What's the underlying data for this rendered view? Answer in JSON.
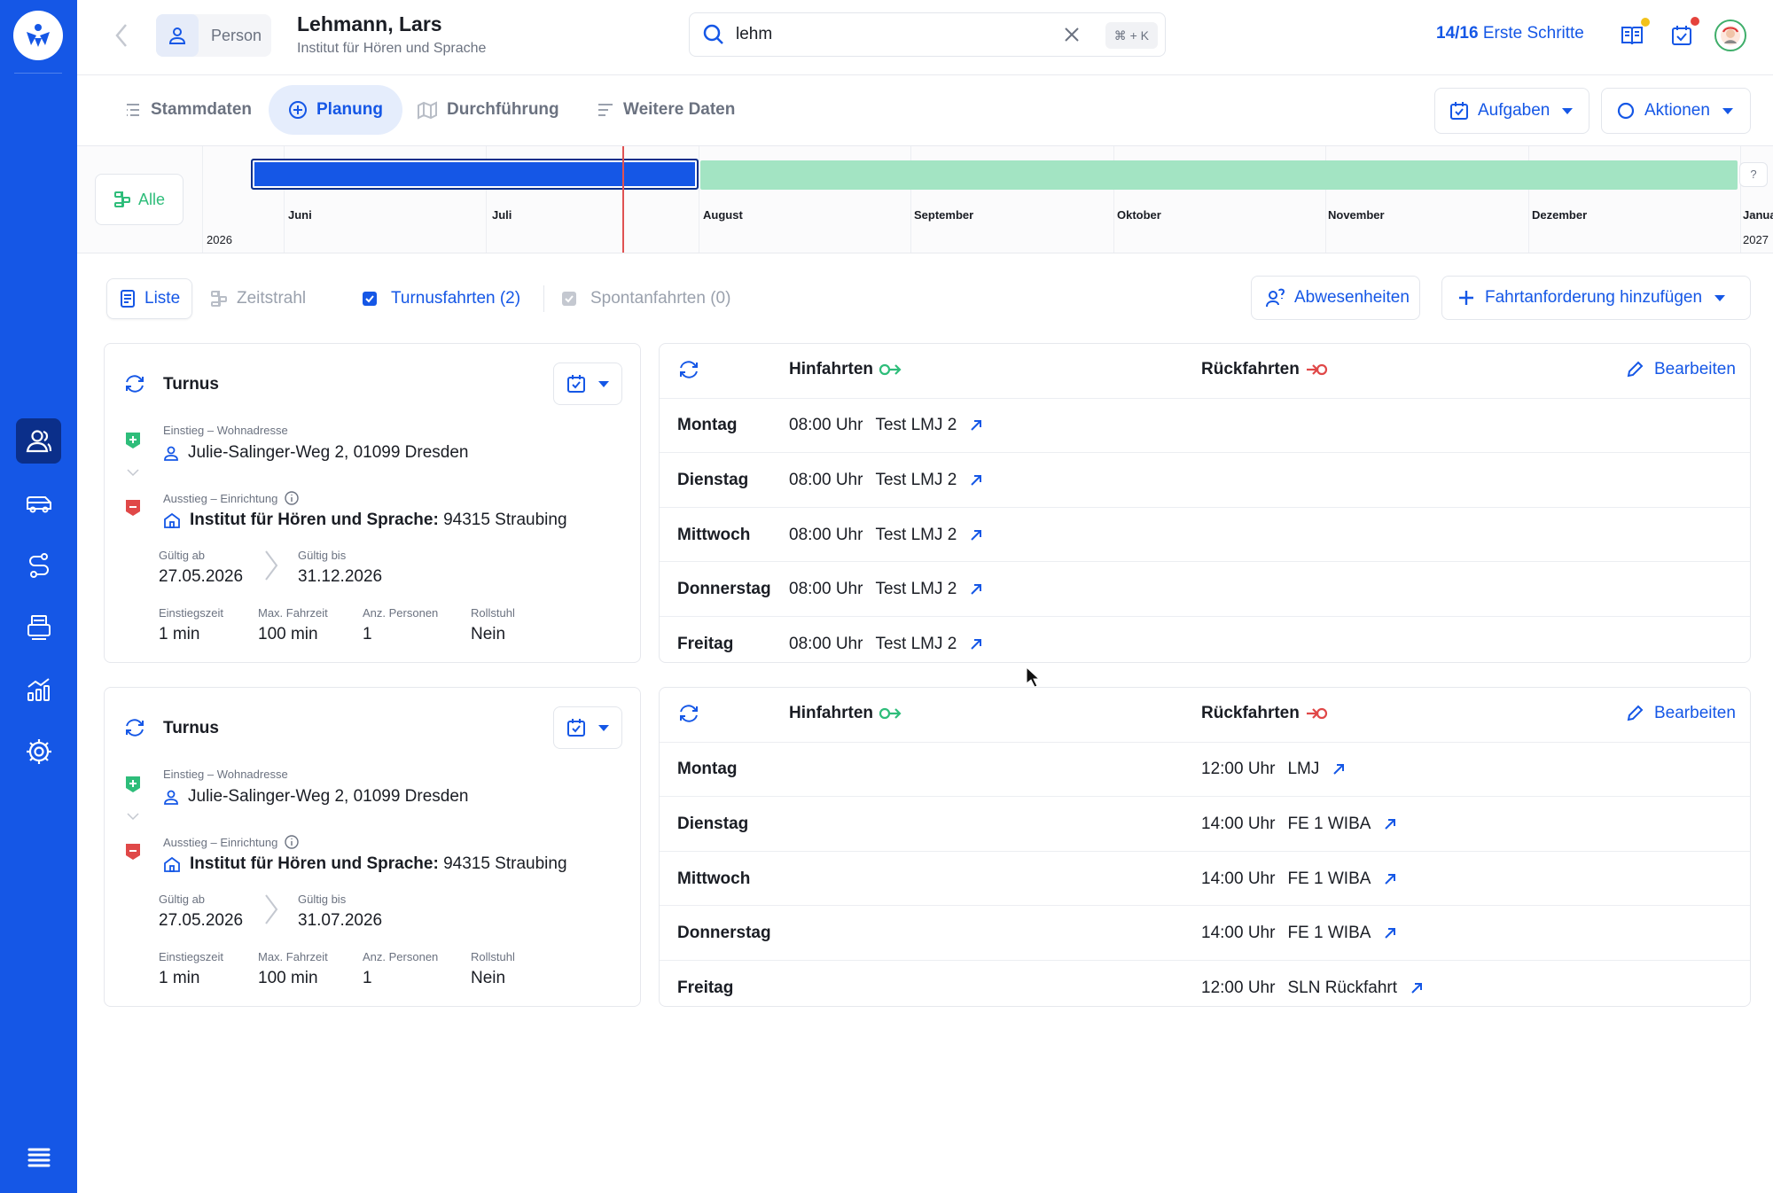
{
  "header": {
    "chip_label": "Person",
    "name": "Lehmann, Lars",
    "subtitle": "Institut für Hören und Sprache",
    "search_value": "lehm",
    "search_shortcut": "⌘ + K",
    "steps_count": "14/16",
    "steps_label": "Erste Schritte"
  },
  "sidebar": {
    "items": [
      "contacts-icon",
      "vehicle-icon",
      "route-icon",
      "print-icon",
      "analytics-icon",
      "settings-icon"
    ],
    "active": "contacts-icon"
  },
  "tabs": [
    {
      "label": "Stammdaten"
    },
    {
      "label": "Planung"
    },
    {
      "label": "Durchführung"
    },
    {
      "label": "Weitere Daten"
    }
  ],
  "actions": {
    "tasks_label": "Aufgaben",
    "actions_label": "Aktionen"
  },
  "timeline": {
    "filter_label": "Alle",
    "months": [
      "Juni",
      "Juli",
      "August",
      "September",
      "Oktober",
      "November",
      "Dezember",
      "Janua"
    ],
    "year_start": "2026",
    "year_end": "2027",
    "help": "?"
  },
  "filters": {
    "list_label": "Liste",
    "timeline_label": "Zeitstrahl",
    "turnus_label": "Turnusfahrten (2)",
    "spontan_label": "Spontanfahrten (0)",
    "absences_label": "Abwesenheiten",
    "add_label": "Fahrtanforderung hinzufügen"
  },
  "turnus": [
    {
      "title": "Turnus",
      "pickup_label": "Einstieg – Wohnadresse",
      "pickup_address": "Julie-Salinger-Weg 2, 01099 Dresden",
      "dropoff_label": "Ausstieg – Einrichtung",
      "dropoff_name": "Institut für Hören und Sprache:",
      "dropoff_city": "94315 Straubing",
      "valid_from_label": "Gültig ab",
      "valid_from": "27.05.2026",
      "valid_to_label": "Gültig bis",
      "valid_to": "31.12.2026",
      "boarding_label": "Einstiegszeit",
      "boarding": "1 min",
      "maxride_label": "Max. Fahrzeit",
      "maxride": "100 min",
      "persons_label": "Anz. Personen",
      "persons": "1",
      "wheelchair_label": "Rollstuhl",
      "wheelchair": "Nein"
    },
    {
      "title": "Turnus",
      "pickup_label": "Einstieg – Wohnadresse",
      "pickup_address": "Julie-Salinger-Weg 2, 01099 Dresden",
      "dropoff_label": "Ausstieg – Einrichtung",
      "dropoff_name": "Institut für Hören und Sprache:",
      "dropoff_city": "94315 Straubing",
      "valid_from_label": "Gültig ab",
      "valid_from": "27.05.2026",
      "valid_to_label": "Gültig bis",
      "valid_to": "31.07.2026",
      "boarding_label": "Einstiegszeit",
      "boarding": "1 min",
      "maxride_label": "Max. Fahrzeit",
      "maxride": "100 min",
      "persons_label": "Anz. Personen",
      "persons": "1",
      "wheelchair_label": "Rollstuhl",
      "wheelchair": "Nein"
    }
  ],
  "schedules": [
    {
      "outbound_label": "Hinfahrten",
      "return_label": "Rückfahrten",
      "edit_label": "Bearbeiten",
      "rows": [
        {
          "day": "Montag",
          "out_time": "08:00 Uhr",
          "out_name": "Test LMJ 2"
        },
        {
          "day": "Dienstag",
          "out_time": "08:00 Uhr",
          "out_name": "Test LMJ 2"
        },
        {
          "day": "Mittwoch",
          "out_time": "08:00 Uhr",
          "out_name": "Test LMJ 2"
        },
        {
          "day": "Donnerstag",
          "out_time": "08:00 Uhr",
          "out_name": "Test LMJ 2"
        },
        {
          "day": "Freitag",
          "out_time": "08:00 Uhr",
          "out_name": "Test LMJ 2"
        }
      ]
    },
    {
      "outbound_label": "Hinfahrten",
      "return_label": "Rückfahrten",
      "edit_label": "Bearbeiten",
      "rows": [
        {
          "day": "Montag",
          "ret_time": "12:00 Uhr",
          "ret_name": "LMJ"
        },
        {
          "day": "Dienstag",
          "ret_time": "14:00 Uhr",
          "ret_name": "FE 1 WIBA"
        },
        {
          "day": "Mittwoch",
          "ret_time": "14:00 Uhr",
          "ret_name": "FE 1 WIBA"
        },
        {
          "day": "Donnerstag",
          "ret_time": "14:00 Uhr",
          "ret_name": "FE 1 WIBA"
        },
        {
          "day": "Freitag",
          "ret_time": "12:00 Uhr",
          "ret_name": "SLN Rückfahrt"
        }
      ]
    }
  ],
  "colors": {
    "primary": "#1557e6",
    "sidebar": "#1557e6",
    "active_nav": "#0b2f8a",
    "period_active": "#1557e6",
    "period_rest": "#a3e4c3",
    "today_line": "#e05252",
    "pickup_green": "#2ebd7a",
    "dropoff_red": "#e04848"
  }
}
